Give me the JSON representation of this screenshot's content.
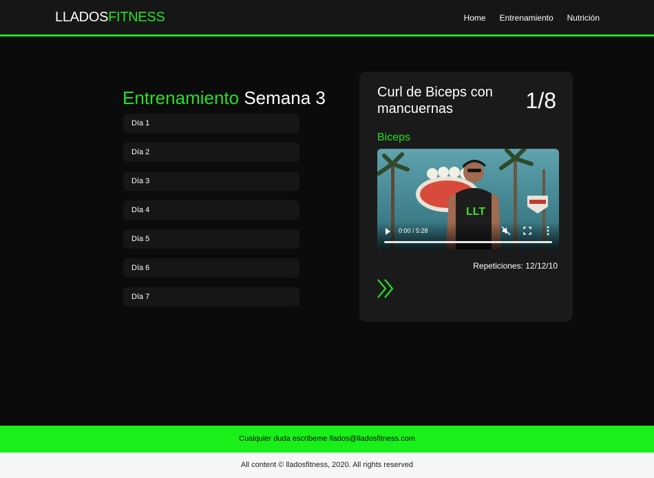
{
  "header": {
    "logo_part1": "LLADOS",
    "logo_part2": "FITNESS",
    "nav": [
      "Home",
      "Entrenamiento",
      "Nutrición"
    ]
  },
  "main": {
    "title_green": "Entrenamiento",
    "title_white": " Semana 3",
    "days": [
      "Día 1",
      "Día 2",
      "Día 3",
      "Día 4",
      "Día 5",
      "Día 6",
      "Día 7"
    ]
  },
  "exercise": {
    "name": "Curl de Biceps con mancuernas",
    "counter": "1/8",
    "muscle": "Biceps",
    "video_time": "0:00 / 5:28",
    "reps_text": "Repeticiones: 12/12/10",
    "video_logo": "LLT"
  },
  "footer": {
    "contact_text": "Cualquier duda escribeme llados@lladosfitness.com",
    "copyright_text": "All content © lladosfitness, 2020. All rights reserved"
  },
  "colors": {
    "accent": "#25e025",
    "footer_green": "#19f019",
    "background": "#0b0b0b",
    "card": "#1a1a1a"
  }
}
